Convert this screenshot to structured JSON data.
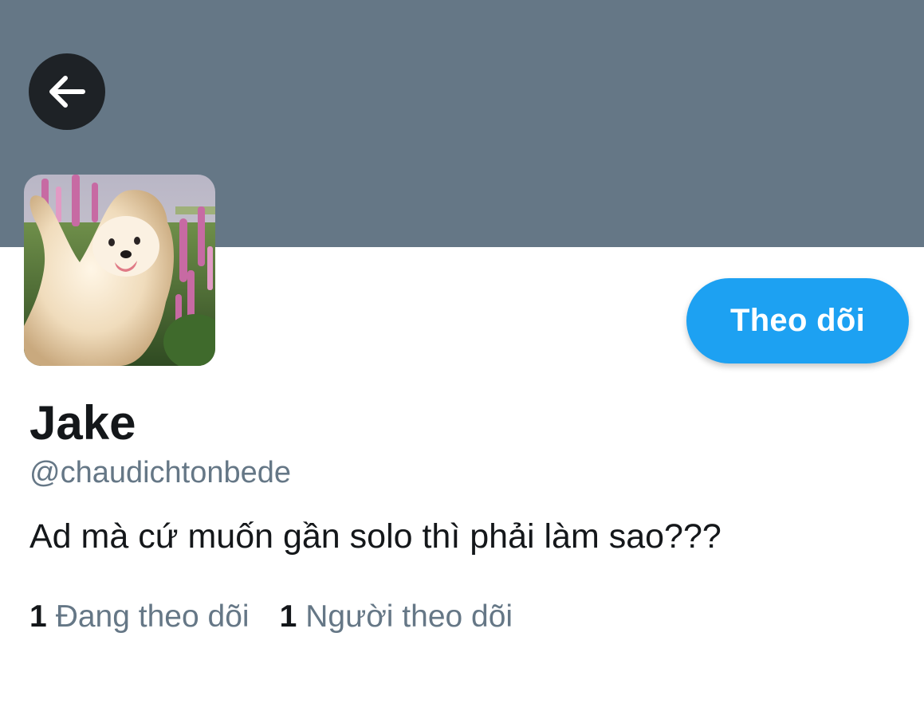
{
  "profile": {
    "display_name": "Jake",
    "handle": "@chaudichtonbede",
    "bio": "Ad mà cứ muốn gần solo thì phải làm sao???",
    "avatar_subject": "white dog waving among pink lupine flowers"
  },
  "header": {
    "back_icon": "arrow-left-icon",
    "banner_color": "#657786"
  },
  "actions": {
    "follow_label": "Theo dõi",
    "follow_color": "#1da1f2"
  },
  "stats": {
    "following_count": "1",
    "following_label": "Đang theo dõi",
    "followers_count": "1",
    "followers_label": "Người theo dõi"
  }
}
